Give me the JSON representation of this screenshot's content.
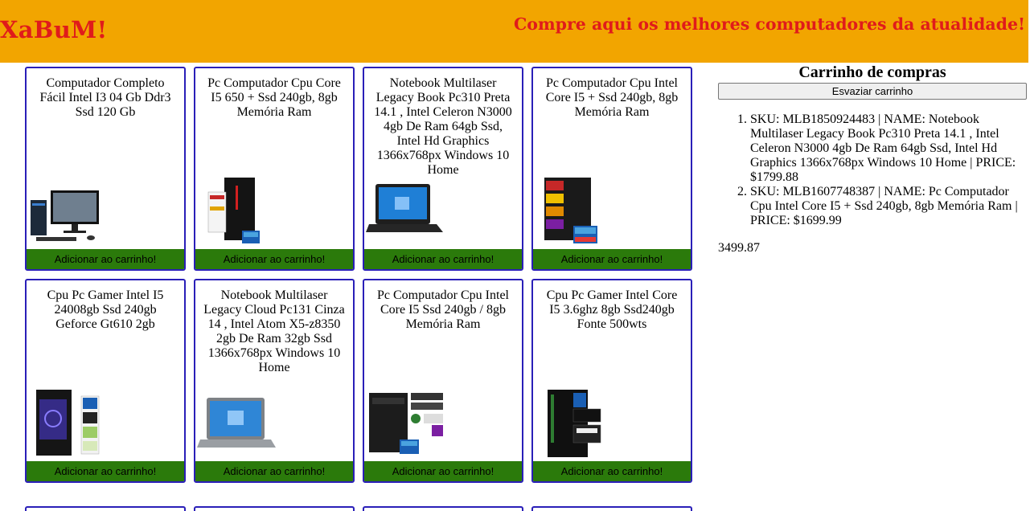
{
  "header": {
    "brand": "XaBuM!",
    "tagline": "Compre aqui os melhores computadores da atualidade!"
  },
  "products": [
    {
      "title": "Computador Completo Fácil Intel I3 04 Gb Ddr3 Ssd 120 Gb",
      "button": "Adicionar ao carrinho!",
      "image": "desktop-monitor-set"
    },
    {
      "title": "Pc Computador Cpu Core I5 650 + Ssd 240gb, 8gb Memória Ram",
      "button": "Adicionar ao carrinho!",
      "image": "pc-tower-red"
    },
    {
      "title": "Notebook Multilaser Legacy Book Pc310 Preta 14.1 , Intel Celeron N3000 4gb De Ram 64gb Ssd, Intel Hd Graphics 1366x768px Windows 10 Home",
      "button": "Adicionar ao carrinho!",
      "image": "laptop-black"
    },
    {
      "title": "Pc Computador Cpu Intel Core I5 + Ssd 240gb, 8gb Memória Ram",
      "button": "Adicionar ao carrinho!",
      "image": "pc-tower-labels"
    },
    {
      "title": "Cpu Pc Gamer Intel I5 24008gb Ssd 240gb Geforce Gt610 2gb",
      "button": "Adicionar ao carrinho!",
      "image": "gamer-tower-blue"
    },
    {
      "title": "Notebook Multilaser Legacy Cloud Pc131 Cinza 14 , Intel Atom X5-z8350 2gb De Ram 32gb Ssd 1366x768px Windows 10 Home",
      "button": "Adicionar ao carrinho!",
      "image": "laptop-gray"
    },
    {
      "title": "Pc Computador Cpu Intel Core I5 Ssd 240gb / 8gb Memória Ram",
      "button": "Adicionar ao carrinho!",
      "image": "pc-tower-badges"
    },
    {
      "title": "Cpu Pc Gamer Intel Core I5 3.6ghz 8gb Ssd240gb Fonte 500wts",
      "button": "Adicionar ao carrinho!",
      "image": "gamer-tower-games"
    }
  ],
  "cart": {
    "title": "Carrinho de compras",
    "empty_button": "Esvaziar carrinho",
    "items": [
      "SKU: MLB1850924483 | NAME: Notebook Multilaser Legacy Book Pc310 Preta 14.1 , Intel Celeron N3000 4gb De Ram 64gb Ssd, Intel Hd Graphics 1366x768px Windows 10 Home | PRICE: $1799.88",
      "SKU: MLB1607748387 | NAME: Pc Computador Cpu Intel Core I5 + Ssd 240gb, 8gb Memória Ram | PRICE: $1699.99"
    ],
    "total": "3499.87"
  },
  "colors": {
    "header_bg": "#f2a500",
    "brand_text": "#e01b1b",
    "card_border": "#2a1fb8",
    "button_bg": "#2b7a0b"
  }
}
